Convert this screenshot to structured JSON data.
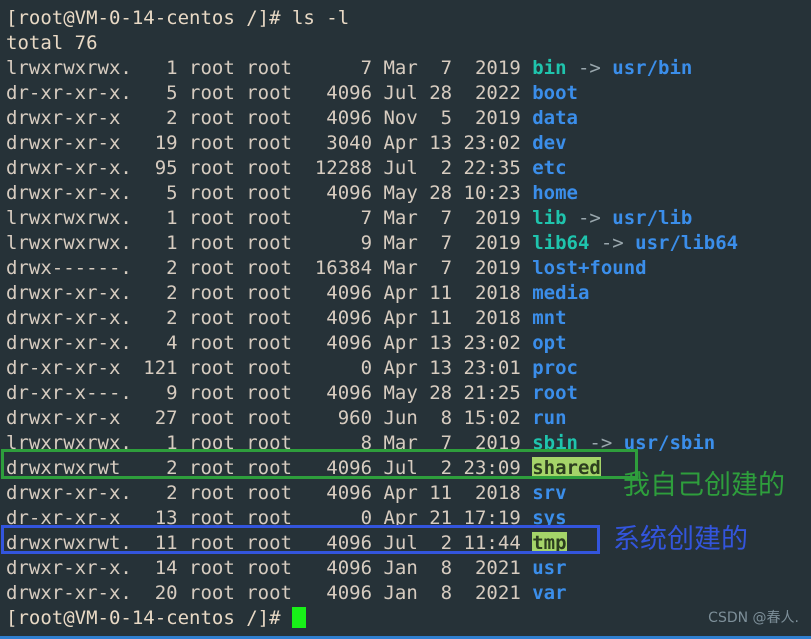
{
  "terminal": {
    "background_color": "#263238",
    "prompt": "[root@VM-0-14-centos /]#",
    "command": " ls -l",
    "total_line": "total 76",
    "trailing_prompt": "[root@VM-0-14-centos /]#",
    "colors": {
      "text": "#e8d9c5",
      "directory": "#3b8eea",
      "symlink": "#1fc4ad",
      "sticky_dir_fg": "#2c3e1f",
      "sticky_dir_bg": "#a5d469",
      "cursor": "#18f018",
      "annotation_green": "#2e9e3c",
      "annotation_blue": "#3355dd",
      "watermark": "#7d8f99",
      "bottom_rule": "#2f7fd0"
    },
    "columns": [
      "permissions",
      "links",
      "owner",
      "group",
      "size",
      "month",
      "day",
      "time",
      "name"
    ],
    "rows": [
      {
        "perm": "lrwxrwxrwx.",
        "links": "1",
        "owner": "root",
        "group": "root",
        "size": "7",
        "month": "Mar",
        "day": "7",
        "time": "2019",
        "name": "bin",
        "kind": "link",
        "arrow": " -> ",
        "target": "usr/bin"
      },
      {
        "perm": "dr-xr-xr-x.",
        "links": "5",
        "owner": "root",
        "group": "root",
        "size": "4096",
        "month": "Jul",
        "day": "28",
        "time": "2022",
        "name": "boot",
        "kind": "dir"
      },
      {
        "perm": "drwxr-xr-x",
        "links": "2",
        "owner": "root",
        "group": "root",
        "size": "4096",
        "month": "Nov",
        "day": "5",
        "time": "2019",
        "name": "data",
        "kind": "dir"
      },
      {
        "perm": "drwxr-xr-x",
        "links": "19",
        "owner": "root",
        "group": "root",
        "size": "3040",
        "month": "Apr",
        "day": "13",
        "time": "23:02",
        "name": "dev",
        "kind": "dir"
      },
      {
        "perm": "drwxr-xr-x.",
        "links": "95",
        "owner": "root",
        "group": "root",
        "size": "12288",
        "month": "Jul",
        "day": "2",
        "time": "22:35",
        "name": "etc",
        "kind": "dir"
      },
      {
        "perm": "drwxr-xr-x.",
        "links": "5",
        "owner": "root",
        "group": "root",
        "size": "4096",
        "month": "May",
        "day": "28",
        "time": "10:23",
        "name": "home",
        "kind": "dir"
      },
      {
        "perm": "lrwxrwxrwx.",
        "links": "1",
        "owner": "root",
        "group": "root",
        "size": "7",
        "month": "Mar",
        "day": "7",
        "time": "2019",
        "name": "lib",
        "kind": "link",
        "arrow": " -> ",
        "target": "usr/lib"
      },
      {
        "perm": "lrwxrwxrwx.",
        "links": "1",
        "owner": "root",
        "group": "root",
        "size": "9",
        "month": "Mar",
        "day": "7",
        "time": "2019",
        "name": "lib64",
        "kind": "link",
        "arrow": " -> ",
        "target": "usr/lib64"
      },
      {
        "perm": "drwx------.",
        "links": "2",
        "owner": "root",
        "group": "root",
        "size": "16384",
        "month": "Mar",
        "day": "7",
        "time": "2019",
        "name": "lost+found",
        "kind": "dir"
      },
      {
        "perm": "drwxr-xr-x.",
        "links": "2",
        "owner": "root",
        "group": "root",
        "size": "4096",
        "month": "Apr",
        "day": "11",
        "time": "2018",
        "name": "media",
        "kind": "dir"
      },
      {
        "perm": "drwxr-xr-x.",
        "links": "2",
        "owner": "root",
        "group": "root",
        "size": "4096",
        "month": "Apr",
        "day": "11",
        "time": "2018",
        "name": "mnt",
        "kind": "dir"
      },
      {
        "perm": "drwxr-xr-x.",
        "links": "4",
        "owner": "root",
        "group": "root",
        "size": "4096",
        "month": "Apr",
        "day": "13",
        "time": "23:02",
        "name": "opt",
        "kind": "dir"
      },
      {
        "perm": "dr-xr-xr-x",
        "links": "121",
        "owner": "root",
        "group": "root",
        "size": "0",
        "month": "Apr",
        "day": "13",
        "time": "23:01",
        "name": "proc",
        "kind": "dir"
      },
      {
        "perm": "dr-xr-x---.",
        "links": "9",
        "owner": "root",
        "group": "root",
        "size": "4096",
        "month": "May",
        "day": "28",
        "time": "21:25",
        "name": "root",
        "kind": "dir"
      },
      {
        "perm": "drwxr-xr-x",
        "links": "27",
        "owner": "root",
        "group": "root",
        "size": "960",
        "month": "Jun",
        "day": "8",
        "time": "15:02",
        "name": "run",
        "kind": "dir"
      },
      {
        "perm": "lrwxrwxrwx.",
        "links": "1",
        "owner": "root",
        "group": "root",
        "size": "8",
        "month": "Mar",
        "day": "7",
        "time": "2019",
        "name": "sbin",
        "kind": "link",
        "arrow": " -> ",
        "target": "usr/sbin"
      },
      {
        "perm": "drwxrwxrwt",
        "links": "2",
        "owner": "root",
        "group": "root",
        "size": "4096",
        "month": "Jul",
        "day": "2",
        "time": "23:09",
        "name": "shared",
        "kind": "sticky"
      },
      {
        "perm": "drwxr-xr-x.",
        "links": "2",
        "owner": "root",
        "group": "root",
        "size": "4096",
        "month": "Apr",
        "day": "11",
        "time": "2018",
        "name": "srv",
        "kind": "dir"
      },
      {
        "perm": "dr-xr-xr-x",
        "links": "13",
        "owner": "root",
        "group": "root",
        "size": "0",
        "month": "Apr",
        "day": "21",
        "time": "17:19",
        "name": "sys",
        "kind": "dir"
      },
      {
        "perm": "drwxrwxrwt.",
        "links": "11",
        "owner": "root",
        "group": "root",
        "size": "4096",
        "month": "Jul",
        "day": "2",
        "time": "11:44",
        "name": "tmp",
        "kind": "sticky"
      },
      {
        "perm": "drwxr-xr-x.",
        "links": "14",
        "owner": "root",
        "group": "root",
        "size": "4096",
        "month": "Jan",
        "day": "8",
        "time": "2021",
        "name": "usr",
        "kind": "dir"
      },
      {
        "perm": "drwxr-xr-x.",
        "links": "20",
        "owner": "root",
        "group": "root",
        "size": "4096",
        "month": "Jan",
        "day": "8",
        "time": "2021",
        "name": "var",
        "kind": "dir"
      }
    ]
  },
  "annotations": {
    "shared_note": "我自己创建的",
    "tmp_note": "系统创建的"
  },
  "watermark": {
    "text": "CSDN @春人."
  }
}
